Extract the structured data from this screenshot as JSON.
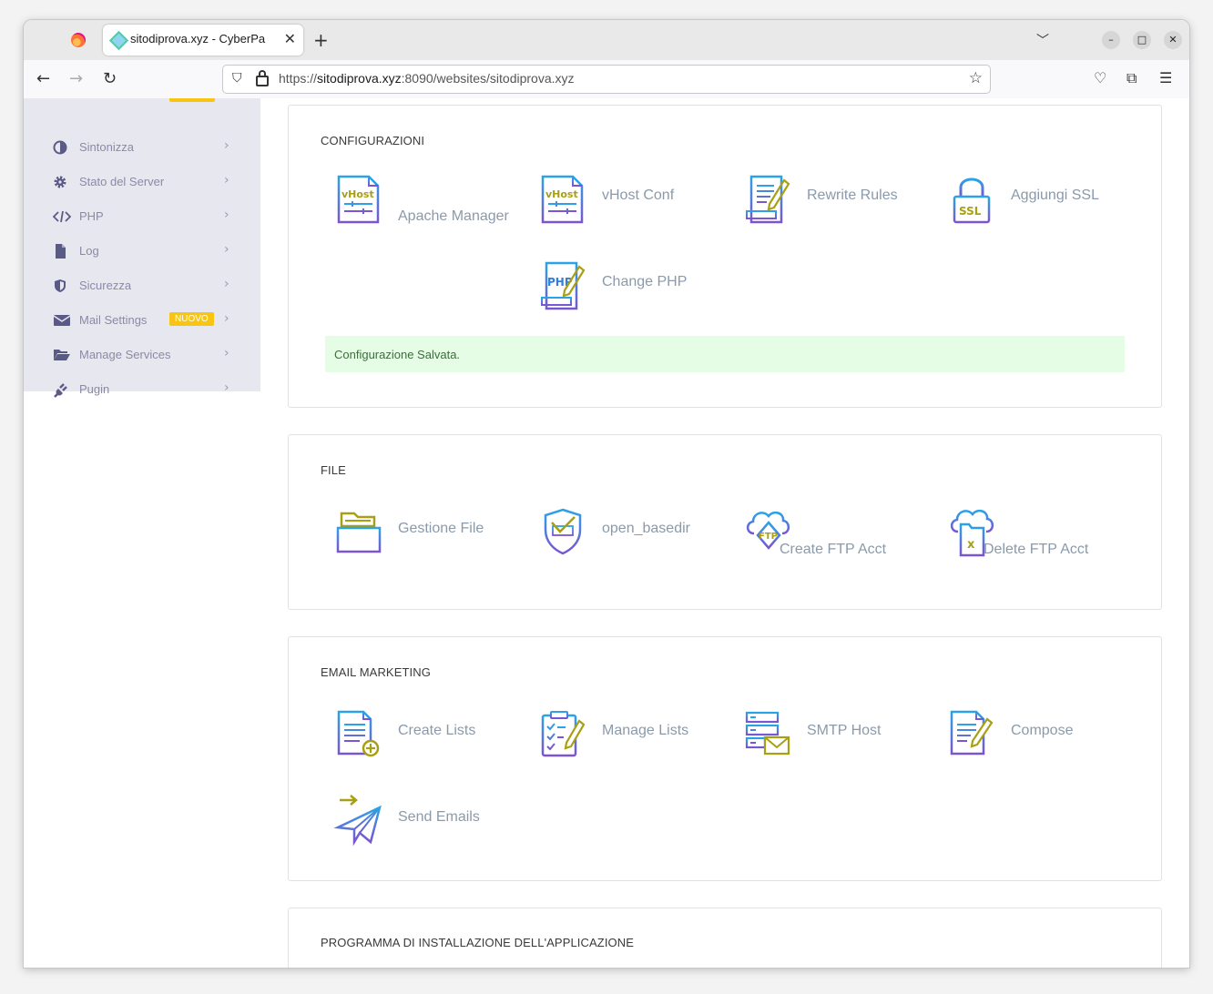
{
  "browser": {
    "tab_title": "sitodiprova.xyz - CyberPa",
    "url_prefix": "https://",
    "url_domain": "sitodiprova.xyz",
    "url_rest": ":8090/websites/sitodiprova.xyz"
  },
  "sidebar": {
    "items": [
      {
        "label": "Sintonizza",
        "icon": "half-circle-icon"
      },
      {
        "label": "Stato del Server",
        "icon": "gear-icon"
      },
      {
        "label": "PHP",
        "icon": "code-icon"
      },
      {
        "label": "Log",
        "icon": "file-icon"
      },
      {
        "label": "Sicurezza",
        "icon": "shield-icon"
      },
      {
        "label": "Mail Settings",
        "icon": "envelope-icon",
        "badge": "NUOVO"
      },
      {
        "label": "Manage Services",
        "icon": "folder-open-icon"
      },
      {
        "label": "Pugin",
        "icon": "plug-icon"
      }
    ]
  },
  "sections": {
    "config": {
      "title": "CONFIGURAZIONI",
      "tiles": [
        "Apache Manager",
        "vHost Conf",
        "Rewrite Rules",
        "Aggiungi SSL",
        "Change PHP"
      ],
      "alert": "Configurazione Salvata."
    },
    "file": {
      "title": "FILE",
      "tiles": [
        "Gestione File",
        "open_basedir",
        "Create FTP Acct",
        "Delete FTP Acct"
      ]
    },
    "email": {
      "title": "EMAIL MARKETING",
      "tiles": [
        "Create Lists",
        "Manage Lists",
        "SMTP Host",
        "Compose",
        "Send Emails"
      ]
    },
    "installer": {
      "title": "PROGRAMMA DI INSTALLAZIONE DELL'APPLICAZIONE"
    }
  },
  "colors": {
    "icon_blue": "#2f7fe0",
    "icon_olive": "#a8a012",
    "icon_purple": "#7a5fc8",
    "badge": "#f9c514",
    "alert_bg": "#e5fde5"
  }
}
